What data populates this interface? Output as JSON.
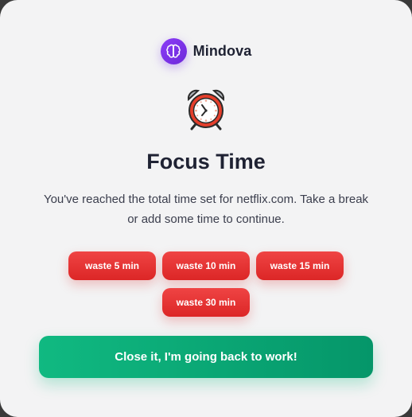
{
  "brand": {
    "name": "Mindova",
    "logo_icon": "brain-icon",
    "logo_color": "#7c3aed"
  },
  "hero": {
    "icon": "alarm-clock-icon",
    "title": "Focus Time",
    "message": "You've reached the total time set for netflix.com. Take a break or add some time to continue."
  },
  "waste_buttons": [
    {
      "label": "waste 5 min"
    },
    {
      "label": "waste 10 min"
    },
    {
      "label": "waste 15 min"
    },
    {
      "label": "waste 30 min"
    }
  ],
  "primary_action": {
    "label": "Close it, I'm going back to work!"
  },
  "colors": {
    "waste": "#dc2626",
    "primary": "#10b981",
    "text": "#1f2233",
    "background": "#f3f3f4"
  }
}
